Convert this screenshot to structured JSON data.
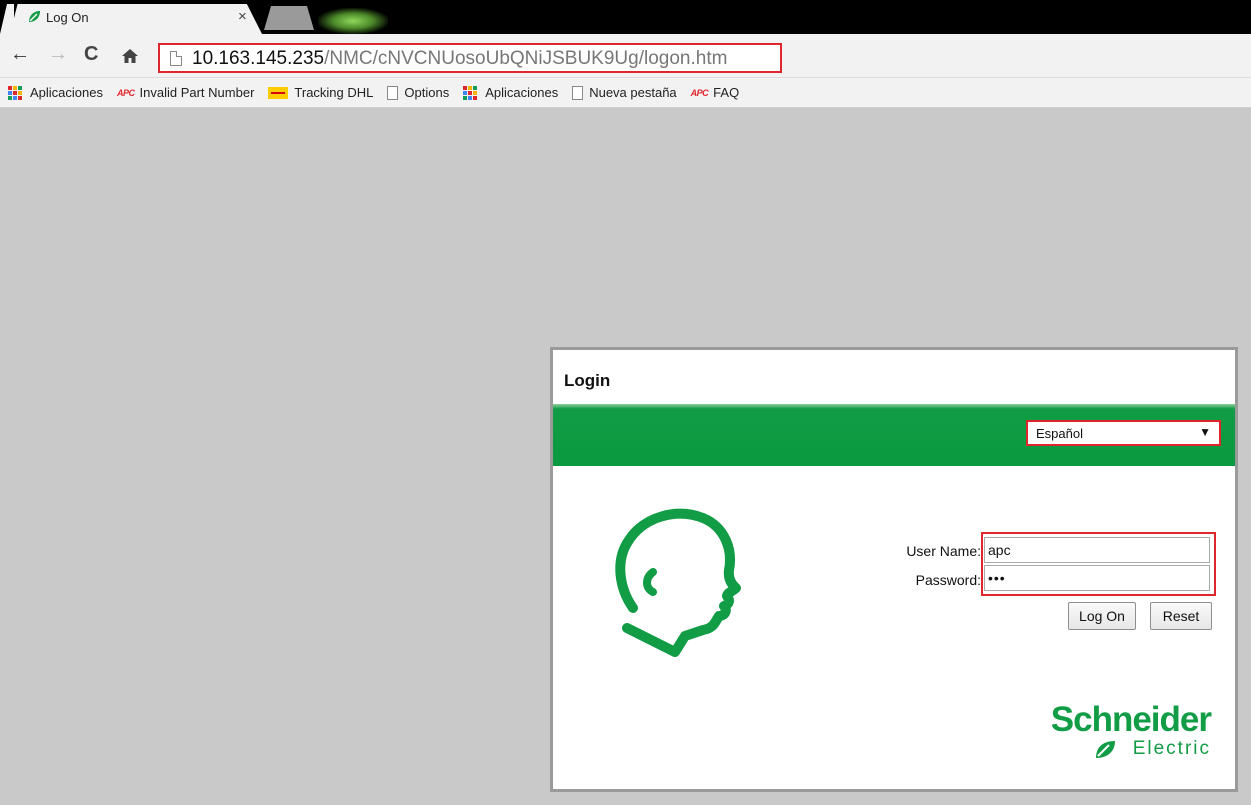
{
  "browser": {
    "tab": {
      "title": "Log On",
      "close_glyph": "×",
      "favicon": "schneider-leaf-icon"
    },
    "toolbar": {
      "back": "←",
      "forward": "→",
      "reload": "C",
      "home": "⌂",
      "url_host": "10.163.145.235",
      "url_path": "/NMC/cNVCNUosoUbQNiJSBUK9Ug/logon.htm"
    },
    "bookmarks": [
      {
        "label": "Aplicaciones",
        "icon": "apps-grid-icon"
      },
      {
        "label": "Invalid Part Number",
        "icon": "apc-logo-icon",
        "icon_text": "APC"
      },
      {
        "label": "Tracking DHL",
        "icon": "dhl-logo-icon"
      },
      {
        "label": "Options",
        "icon": "page-icon"
      },
      {
        "label": "Aplicaciones",
        "icon": "apps-grid-icon"
      },
      {
        "label": "Nueva pestaña",
        "icon": "page-icon"
      },
      {
        "label": "FAQ",
        "icon": "apc-logo-icon",
        "icon_text": "APC"
      }
    ]
  },
  "login": {
    "title": "Login",
    "language": {
      "selected": "Español",
      "arrow": "▼"
    },
    "username_label": "User Name:",
    "username_value": "apc",
    "password_label": "Password:",
    "password_value": "•••",
    "logon_button": "Log On",
    "reset_button": "Reset",
    "brand_name": "Schneider",
    "brand_sub": "Electric"
  },
  "colors": {
    "accent_green": "#119c45",
    "highlight_red": "#e0262d",
    "page_background": "#c9c9c9"
  }
}
